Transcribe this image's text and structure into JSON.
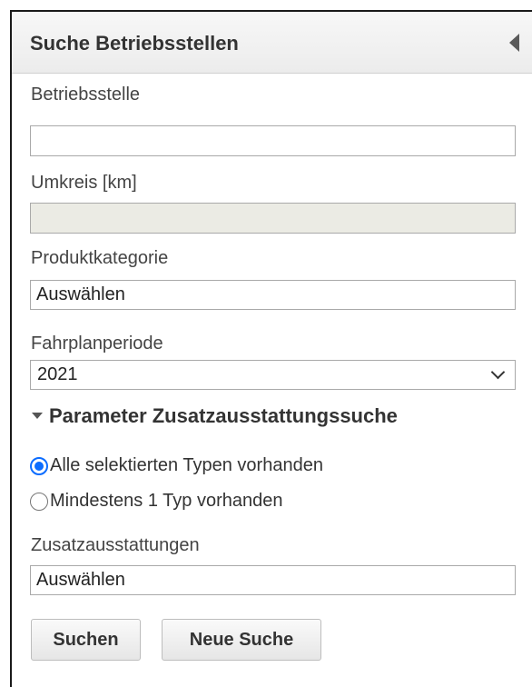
{
  "panel": {
    "title": "Suche Betriebsstellen",
    "collapse_icon": "triangle-left-icon"
  },
  "fields": {
    "betriebsstelle": {
      "label": "Betriebsstelle",
      "value": ""
    },
    "umkreis": {
      "label": "Umkreis [km]",
      "value": "",
      "disabled": true
    },
    "produktkategorie": {
      "label": "Produktkategorie",
      "value": "Auswählen"
    },
    "fahrplanperiode": {
      "label": "Fahrplanperiode",
      "selected": "2021"
    }
  },
  "zusatz_section": {
    "title": "Parameter Zusatzausstattungssuche",
    "expanded": true,
    "radio_all": {
      "label": "Alle selektierten Typen vorhanden",
      "checked": true
    },
    "radio_min": {
      "label": "Mindestens 1 Typ vorhanden",
      "checked": false
    },
    "zusatzausstattungen": {
      "label": "Zusatzausstattungen",
      "value": "Auswählen"
    }
  },
  "buttons": {
    "search": "Suchen",
    "new_search": "Neue Suche"
  },
  "colors": {
    "radio_accent": "#0b6cff",
    "header_bg": "#efefef",
    "disabled_input_bg": "#ebebe4"
  }
}
